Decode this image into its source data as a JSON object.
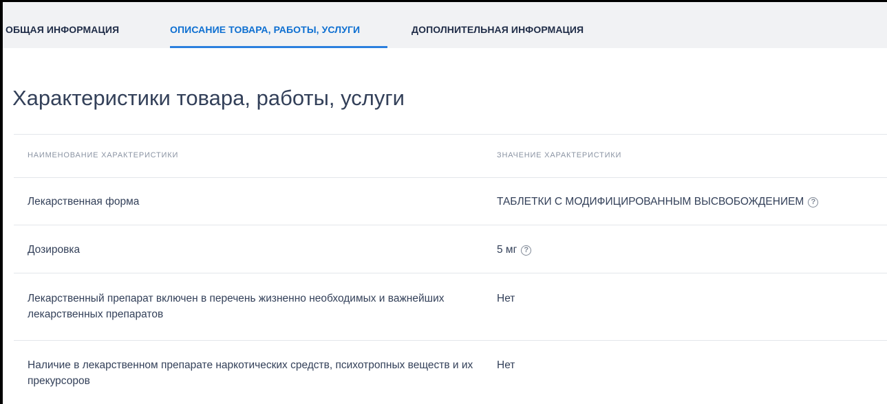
{
  "tabs": [
    {
      "label": "ОБЩАЯ ИНФОРМАЦИЯ"
    },
    {
      "label": "ОПИСАНИЕ ТОВАРА, РАБОТЫ, УСЛУГИ"
    },
    {
      "label": "ДОПОЛНИТЕЛЬНАЯ ИНФОРМАЦИЯ"
    }
  ],
  "active_tab": "ОПИСАНИЕ ТОВАРА, РАБОТЫ, УСЛУГИ",
  "section": {
    "title": "Характеристики товара, работы, услуги",
    "columns": {
      "name": "НАИМЕНОВАНИЕ ХАРАКТЕРИСТИКИ",
      "value": "ЗНАЧЕНИЕ ХАРАКТЕРИСТИКИ"
    },
    "rows": [
      {
        "name": "Лекарственная форма",
        "value": "ТАБЛЕТКИ С МОДИФИЦИРОВАННЫМ ВЫСВОБОЖДЕНИЕМ",
        "help_icon": "question-circle-icon"
      },
      {
        "name": "Дозировка",
        "value": "5 мг",
        "help_icon": "question-circle-icon"
      },
      {
        "name": "Лекарственный препарат включен в перечень жизненно необходимых и важнейших лекарственных препаратов",
        "value": "Нет"
      },
      {
        "name": "Наличие в лекарственном препарате наркотических средств, психотропных веществ и их прекурсоров",
        "value": "Нет"
      }
    ]
  },
  "help_glyph": "?",
  "colors": {
    "active_tab": "#0d6fd1",
    "tab_underline": "#2a7fde",
    "tabbar_background": "#f1f2f4",
    "text": "#334059",
    "muted": "#8b94a3"
  }
}
